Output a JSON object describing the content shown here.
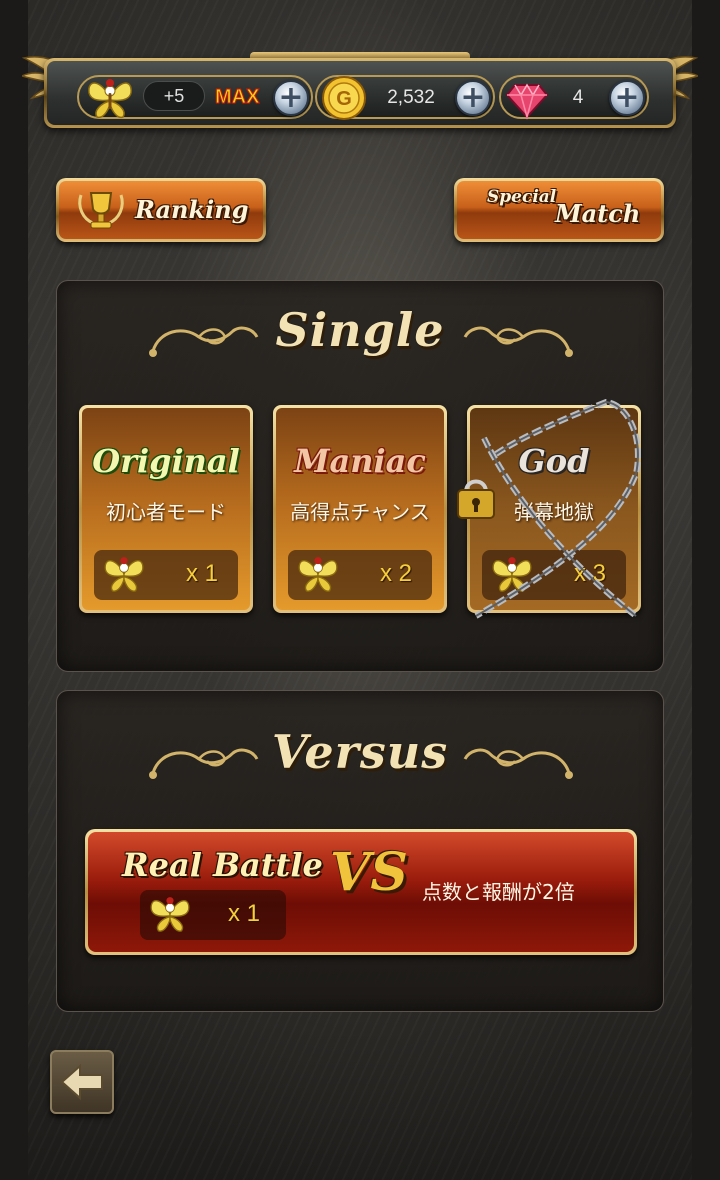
{
  "resources": {
    "stamina": {
      "icon": "butterfly-icon",
      "value": "+5",
      "status": "MAX"
    },
    "gold": {
      "icon": "gold-coin-icon",
      "value": "2,532"
    },
    "gems": {
      "icon": "gem-icon",
      "value": "4"
    }
  },
  "buttons": {
    "ranking": "Ranking",
    "special_match_1": "Special",
    "special_match_2": "Match"
  },
  "single": {
    "title": "Single",
    "modes": [
      {
        "name": "Original",
        "subtitle": "初心者モード",
        "cost": "x 1",
        "locked": false
      },
      {
        "name": "Maniac",
        "subtitle": "高得点チャンス",
        "cost": "x 2",
        "locked": false
      },
      {
        "name": "God",
        "subtitle": "弾幕地獄",
        "cost": "x 3",
        "locked": true
      }
    ]
  },
  "versus": {
    "title": "Versus",
    "battle": {
      "name": "Real Battle",
      "vs": "VS",
      "description": "点数と報酬が2倍",
      "cost": "x 1"
    }
  },
  "colors": {
    "gold": "#d9b970",
    "orange": "#c8601a",
    "red": "#9a1c0c",
    "accent_yellow": "#f6cf3c"
  }
}
